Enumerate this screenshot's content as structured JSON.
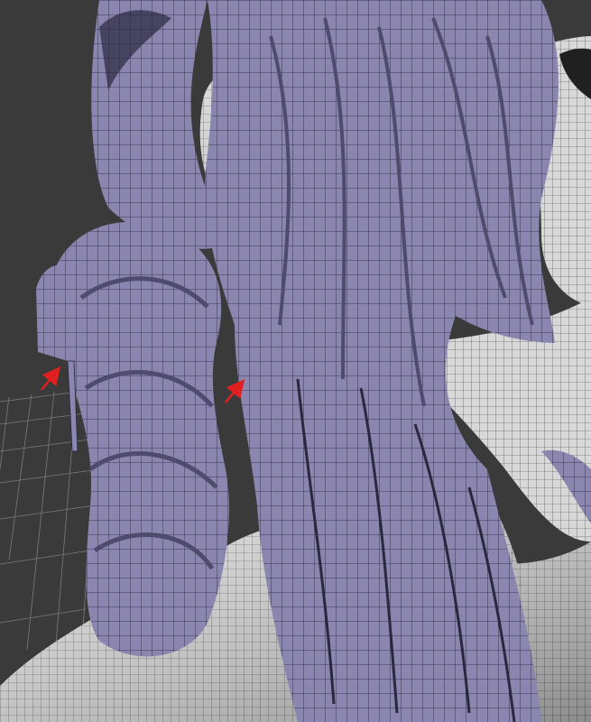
{
  "viewport": {
    "background_color": "#3a3a3a",
    "grid_color": "#8a8a8a",
    "skin_color": "#d9d9d9",
    "hair_color": "#8a86b0",
    "hair_shadow_color": "#4f4b6e",
    "wire_color": "#1e1e2a",
    "annotation_color": "#e02020"
  },
  "annotations": [
    {
      "label": "",
      "icon": "red-arrow-icon"
    },
    {
      "label": "",
      "icon": "red-arrow-icon"
    }
  ]
}
